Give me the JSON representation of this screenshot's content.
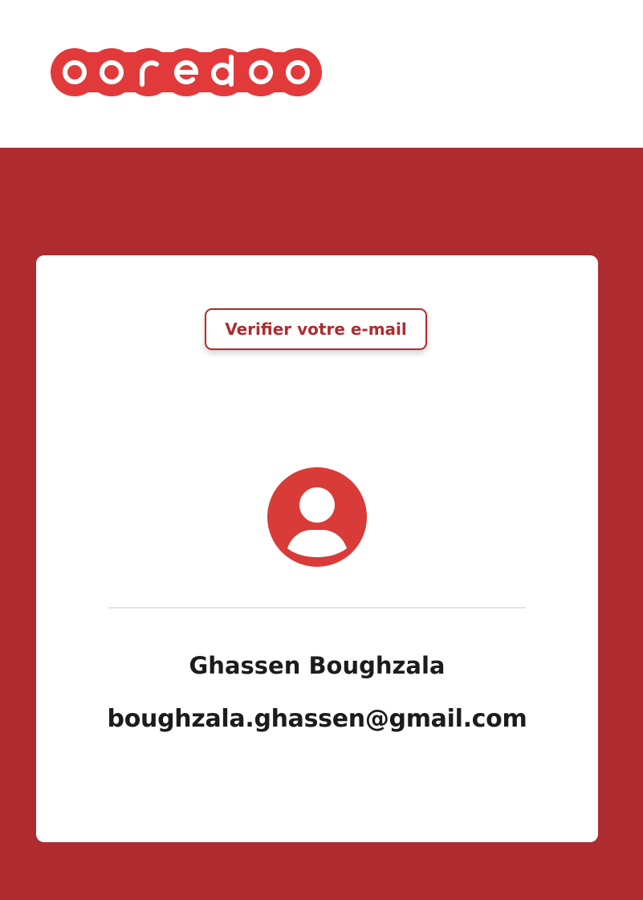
{
  "header": {
    "logo_text": "ooredoo",
    "logo_icon": "ooredoo-logo",
    "background": "#ffffff"
  },
  "theme": {
    "brand_color": "#ae2c30",
    "logo_color": "#e23a3a",
    "avatar_color": "#d93b38",
    "text_color": "#1c1c1c"
  },
  "card": {
    "verify_button_label": "Verifier votre e-mail",
    "avatar_icon": "user-avatar-icon",
    "user_name": "Ghassen Boughzala",
    "user_email": "boughzala.ghassen@gmail.com"
  }
}
